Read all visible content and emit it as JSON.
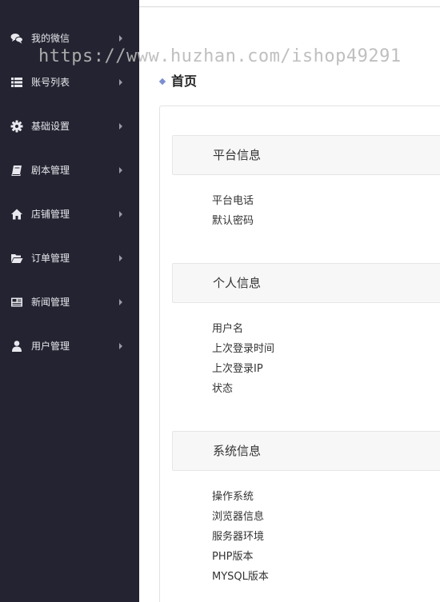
{
  "watermark": "https://www.huzhan.com/ishop49291",
  "sidebar": {
    "items": [
      {
        "label": "我的微信",
        "icon": "chat-bubbles-icon"
      },
      {
        "label": "账号列表",
        "icon": "list-icon"
      },
      {
        "label": "基础设置",
        "icon": "gear-icon"
      },
      {
        "label": "剧本管理",
        "icon": "book-icon"
      },
      {
        "label": "店铺管理",
        "icon": "home-icon"
      },
      {
        "label": "订单管理",
        "icon": "folder-open-icon"
      },
      {
        "label": "新闻管理",
        "icon": "newspaper-icon"
      },
      {
        "label": "用户管理",
        "icon": "user-icon"
      }
    ]
  },
  "breadcrumb": {
    "title": "首页"
  },
  "sections": [
    {
      "title": "平台信息",
      "rows": [
        "平台电话",
        "默认密码"
      ]
    },
    {
      "title": "个人信息",
      "rows": [
        "用户名",
        "上次登录时间",
        "上次登录IP",
        "状态"
      ]
    },
    {
      "title": "系统信息",
      "rows": [
        "操作系统",
        "浏览器信息",
        "服务器环境",
        "PHP版本",
        "MYSQL版本"
      ]
    }
  ],
  "colors": {
    "sidebar_bg": "#232331",
    "accent": "#7c8fd0"
  }
}
